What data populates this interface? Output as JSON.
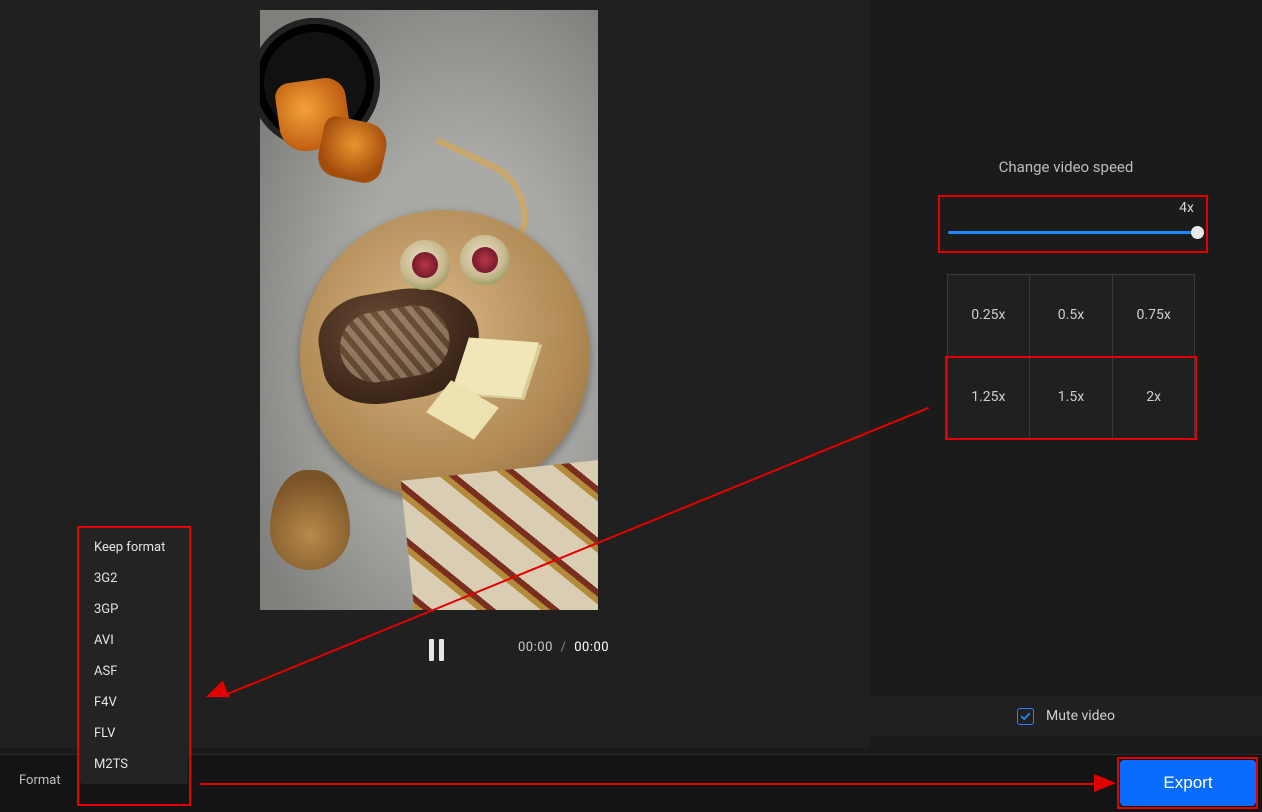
{
  "preview": {
    "time_current": "00:00",
    "time_separator": "/",
    "time_duration": "00:00"
  },
  "side": {
    "title": "Change video speed",
    "slider_value_label": "4x",
    "speed_presets": [
      "0.25x",
      "0.5x",
      "0.75x",
      "1.25x",
      "1.5x",
      "2x"
    ],
    "mute_label": "Mute video",
    "mute_checked": true
  },
  "bottom": {
    "format_label": "Format",
    "export_label": "Export"
  },
  "format_menu": {
    "items": [
      "Keep format",
      "3G2",
      "3GP",
      "AVI",
      "ASF",
      "F4V",
      "FLV",
      "M2TS"
    ]
  },
  "colors": {
    "accent": "#1e88ff",
    "export": "#0a6cff",
    "highlight": "#e40000"
  }
}
